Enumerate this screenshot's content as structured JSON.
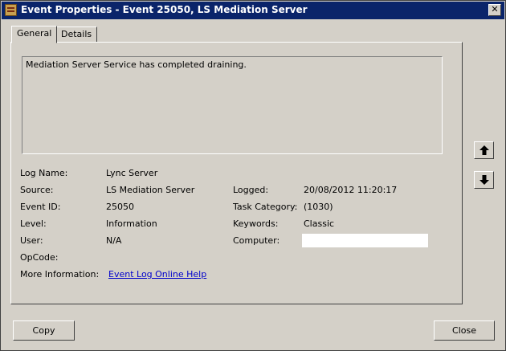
{
  "window": {
    "title": "Event Properties - Event 25050, LS Mediation Server",
    "close_glyph": "✕"
  },
  "tabs": [
    {
      "label": "General"
    },
    {
      "label": "Details"
    }
  ],
  "description": "Mediation Server Service has completed draining.",
  "fields": {
    "log_name": {
      "label": "Log Name:",
      "value": "Lync Server"
    },
    "source": {
      "label": "Source:",
      "value": "LS Mediation Server"
    },
    "event_id": {
      "label": "Event ID:",
      "value": "25050"
    },
    "level": {
      "label": "Level:",
      "value": "Information"
    },
    "user": {
      "label": "User:",
      "value": "N/A"
    },
    "opcode": {
      "label": "OpCode:",
      "value": ""
    },
    "more_info": {
      "label": "More Information:",
      "link": "Event Log Online Help"
    },
    "logged": {
      "label": "Logged:",
      "value": "20/08/2012 11:20:17"
    },
    "task_category": {
      "label": "Task Category:",
      "value": "(1030)"
    },
    "keywords": {
      "label": "Keywords:",
      "value": "Classic"
    },
    "computer": {
      "label": "Computer:",
      "value": ""
    }
  },
  "buttons": {
    "copy": "Copy",
    "close": "Close"
  },
  "icons": {
    "up": "up-arrow-icon",
    "down": "down-arrow-icon"
  }
}
